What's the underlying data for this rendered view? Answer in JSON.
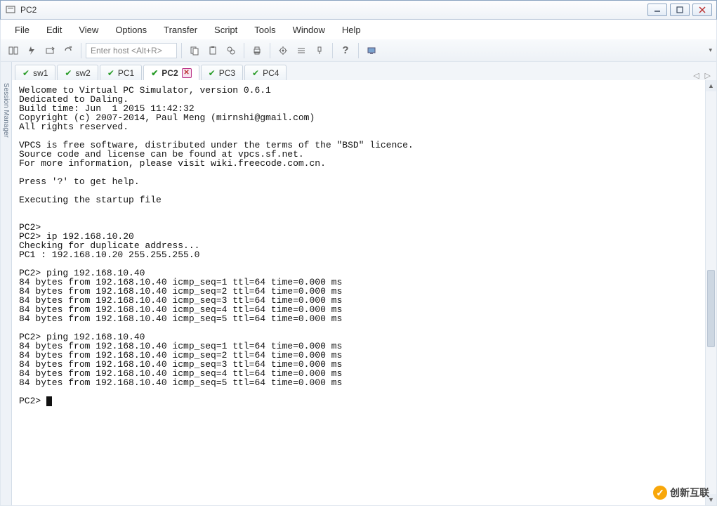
{
  "window": {
    "title": "PC2"
  },
  "menus": [
    "File",
    "Edit",
    "View",
    "Options",
    "Transfer",
    "Script",
    "Tools",
    "Window",
    "Help"
  ],
  "toolbar": {
    "host_placeholder": "Enter host <Alt+R>"
  },
  "tabs": [
    {
      "label": "sw1",
      "active": false
    },
    {
      "label": "sw2",
      "active": false
    },
    {
      "label": "PC1",
      "active": false
    },
    {
      "label": "PC2",
      "active": true
    },
    {
      "label": "PC3",
      "active": false
    },
    {
      "label": "PC4",
      "active": false
    }
  ],
  "session_manager_label": "Session Manager",
  "terminal_text": "Welcome to Virtual PC Simulator, version 0.6.1\nDedicated to Daling.\nBuild time: Jun  1 2015 11:42:32\nCopyright (c) 2007-2014, Paul Meng (mirnshi@gmail.com)\nAll rights reserved.\n\nVPCS is free software, distributed under the terms of the \"BSD\" licence.\nSource code and license can be found at vpcs.sf.net.\nFor more information, please visit wiki.freecode.com.cn.\n\nPress '?' to get help.\n\nExecuting the startup file\n\n\nPC2>\nPC2> ip 192.168.10.20\nChecking for duplicate address...\nPC1 : 192.168.10.20 255.255.255.0\n\nPC2> ping 192.168.10.40\n84 bytes from 192.168.10.40 icmp_seq=1 ttl=64 time=0.000 ms\n84 bytes from 192.168.10.40 icmp_seq=2 ttl=64 time=0.000 ms\n84 bytes from 192.168.10.40 icmp_seq=3 ttl=64 time=0.000 ms\n84 bytes from 192.168.10.40 icmp_seq=4 ttl=64 time=0.000 ms\n84 bytes from 192.168.10.40 icmp_seq=5 ttl=64 time=0.000 ms\n\nPC2> ping 192.168.10.40\n84 bytes from 192.168.10.40 icmp_seq=1 ttl=64 time=0.000 ms\n84 bytes from 192.168.10.40 icmp_seq=2 ttl=64 time=0.000 ms\n84 bytes from 192.168.10.40 icmp_seq=3 ttl=64 time=0.000 ms\n84 bytes from 192.168.10.40 icmp_seq=4 ttl=64 time=0.000 ms\n84 bytes from 192.168.10.40 icmp_seq=5 ttl=64 time=0.000 ms\n\nPC2> ",
  "watermark": "创新互联"
}
